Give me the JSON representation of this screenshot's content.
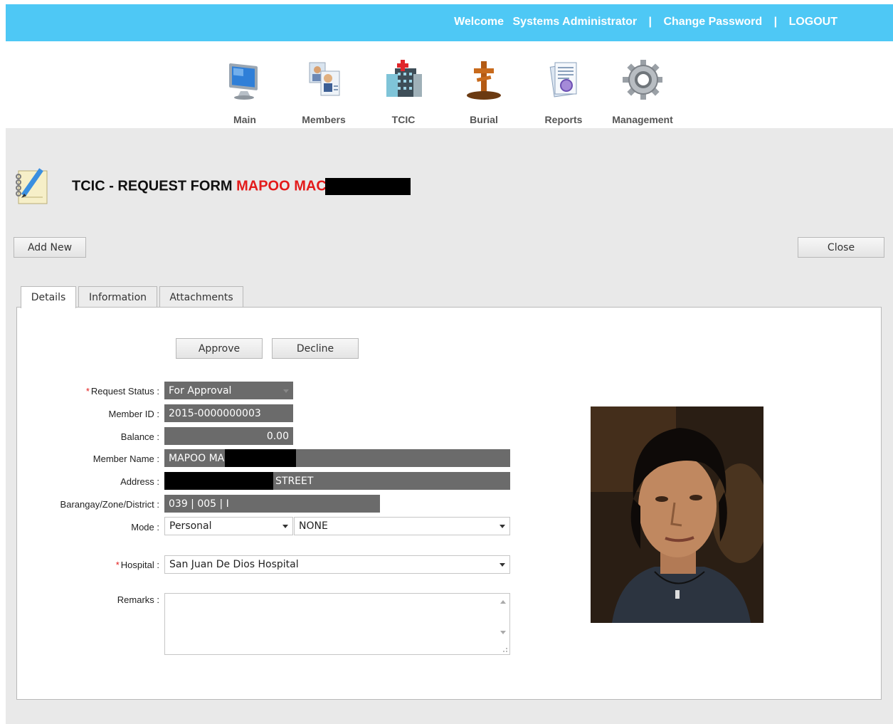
{
  "header": {
    "welcome": "Welcome",
    "user": "Systems Administrator",
    "separator": "|",
    "change_password": "Change Password",
    "logout": "LOGOUT",
    "bg_color": "#4ec8f5"
  },
  "nav": {
    "items": [
      {
        "label": "Main",
        "icon": "monitor-icon"
      },
      {
        "label": "Members",
        "icon": "members-icon"
      },
      {
        "label": "TCIC",
        "icon": "hospital-icon"
      },
      {
        "label": "Burial",
        "icon": "cross-icon"
      },
      {
        "label": "Reports",
        "icon": "reports-icon"
      },
      {
        "label": "Management",
        "icon": "gear-icon"
      }
    ]
  },
  "page": {
    "title_prefix": "TCIC - REQUEST FORM",
    "title_name": "MAPOO MAC",
    "title_icon": "notepad-pencil-icon",
    "add_new": "Add New",
    "close": "Close"
  },
  "tabs": [
    {
      "label": "Details",
      "active": true
    },
    {
      "label": "Information",
      "active": false
    },
    {
      "label": "Attachments",
      "active": false
    }
  ],
  "actions": {
    "approve": "Approve",
    "decline": "Decline"
  },
  "form": {
    "required_mark": "*",
    "request_status": {
      "label": "Request Status :",
      "value": "For Approval"
    },
    "member_id": {
      "label": "Member ID :",
      "value": "2015-0000000003"
    },
    "balance": {
      "label": "Balance :",
      "value": "0.00"
    },
    "member_name": {
      "label": "Member Name :",
      "value": "MAPOO MA"
    },
    "address": {
      "label": "Address :",
      "value": "STREET"
    },
    "barangay": {
      "label": "Barangay/Zone/District :",
      "value": "039 | 005 | I"
    },
    "mode": {
      "label": "Mode :",
      "value": "Personal",
      "value2": "NONE"
    },
    "hospital": {
      "label": "Hospital :",
      "value": "San Juan De Dios Hospital"
    },
    "remarks": {
      "label": "Remarks :",
      "value": ""
    }
  },
  "colors": {
    "accent_red": "#e31b1b",
    "field_gray": "#6b6b6b",
    "content_bg": "#e9e9e9"
  }
}
